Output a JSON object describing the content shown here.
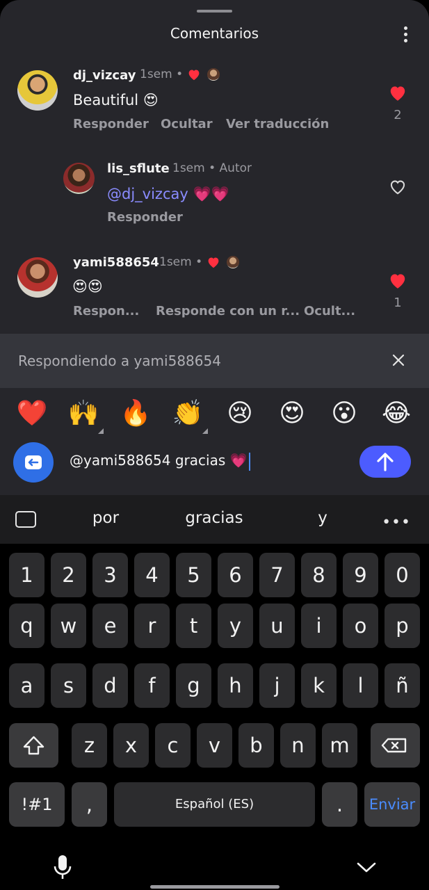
{
  "sheet": {
    "title": "Comentarios"
  },
  "comments": [
    {
      "username": "dj_vizcay",
      "time": "1sem",
      "text": "Beautiful",
      "emoji": "😍",
      "actions": [
        "Responder",
        "Ocultar",
        "Ver traducción"
      ],
      "likes": "2",
      "liked": true
    },
    {
      "username": "lis_sflute",
      "time": "1sem",
      "tag": "Autor",
      "mention": "@dj_vizcay",
      "emoji": "💗💗",
      "actions": [
        "Responder"
      ],
      "liked": false
    },
    {
      "username": "yami588654",
      "time": "1sem",
      "emoji": "😍😍",
      "actions": [
        "Respon...",
        "Responde con un r...",
        "Ocult..."
      ],
      "likes": "1",
      "liked": true
    }
  ],
  "reply_bar": {
    "text": "Respondiendo a yami588654"
  },
  "emoji_bar": [
    "❤️",
    "🙌",
    "🔥",
    "👏",
    "😢",
    "😍",
    "😮",
    "😂"
  ],
  "composer": {
    "value": "@yami588654 gracias 💗"
  },
  "keyboard": {
    "suggestions": [
      "por",
      "gracias",
      "y"
    ],
    "row_numbers": [
      "1",
      "2",
      "3",
      "4",
      "5",
      "6",
      "7",
      "8",
      "9",
      "0"
    ],
    "row1": [
      "q",
      "w",
      "e",
      "r",
      "t",
      "y",
      "u",
      "i",
      "o",
      "p"
    ],
    "row2": [
      "a",
      "s",
      "d",
      "f",
      "g",
      "h",
      "j",
      "k",
      "l",
      "ñ"
    ],
    "row3": [
      "z",
      "x",
      "c",
      "v",
      "b",
      "n",
      "m"
    ],
    "symbols_label": "!#1",
    "comma": ",",
    "space_label": "Español (ES)",
    "period": ".",
    "enter_label": "Enviar"
  },
  "colors": {
    "sheet_bg": "#26262b",
    "like_red": "#ff3040",
    "accent_blue": "#4c5cff",
    "mention": "#8a8cff"
  }
}
